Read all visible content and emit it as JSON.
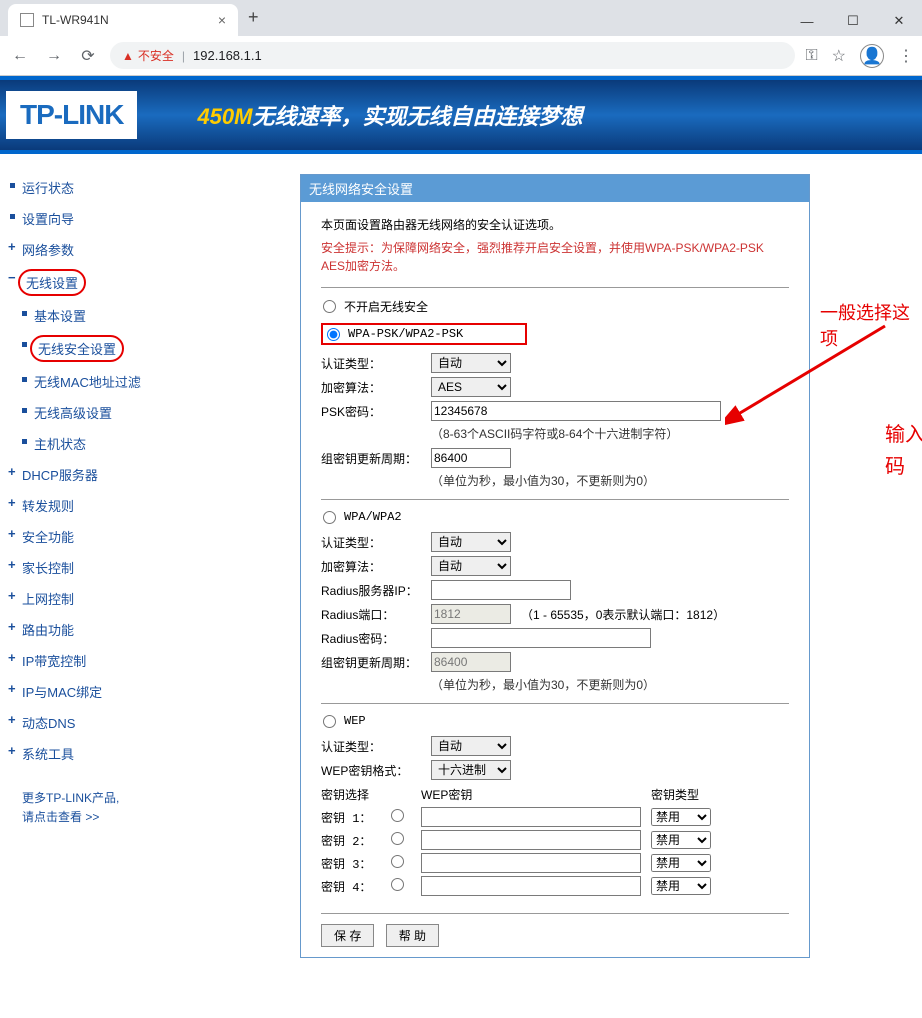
{
  "browser": {
    "tab_title": "TL-WR941N",
    "insecure_label": "不安全",
    "url": "192.168.1.1"
  },
  "banner": {
    "logo": "TP-LINK",
    "slogan_highlight": "450M",
    "slogan_rest": "无线速率，实现无线自由连接梦想"
  },
  "sidebar": {
    "items": [
      "运行状态",
      "设置向导",
      "网络参数",
      "无线设置",
      "基本设置",
      "无线安全设置",
      "无线MAC地址过滤",
      "无线高级设置",
      "主机状态",
      "DHCP服务器",
      "转发规则",
      "安全功能",
      "家长控制",
      "上网控制",
      "路由功能",
      "IP带宽控制",
      "IP与MAC绑定",
      "动态DNS",
      "系统工具"
    ],
    "more1": "更多TP-LINK产品,",
    "more2": "请点击查看 >>"
  },
  "panel": {
    "title": "无线网络安全设置",
    "intro": "本页面设置路由器无线网络的安全认证选项。",
    "warning": "安全提示：为保障网络安全，强烈推荐开启安全设置，并使用WPA-PSK/WPA2-PSK AES加密方法。",
    "opt_disable": "不开启无线安全",
    "opt_wpapsk": "WPA-PSK/WPA2-PSK",
    "auth_type_label": "认证类型：",
    "auth_type_value": "自动",
    "encrypt_label": "加密算法：",
    "encrypt_value_aes": "AES",
    "encrypt_value_auto": "自动",
    "psk_label": "PSK密码：",
    "psk_value": "12345678",
    "psk_hint": "（8-63个ASCII码字符或8-64个十六进制字符）",
    "rekey_label": "组密钥更新周期：",
    "rekey_value": "86400",
    "rekey_hint": "（单位为秒，最小值为30，不更新则为0）",
    "opt_wpa": "WPA/WPA2",
    "radius_ip_label": "Radius服务器IP：",
    "radius_port_label": "Radius端口：",
    "radius_port_value": "1812",
    "radius_port_hint": "（1 - 65535，0表示默认端口：1812）",
    "radius_pw_label": "Radius密码：",
    "rekey2_value": "86400",
    "opt_wep": "WEP",
    "wep_format_label": "WEP密钥格式：",
    "wep_format_value": "十六进制",
    "wep_col_select": "密钥选择",
    "wep_col_key": "WEP密钥",
    "wep_col_type": "密钥类型",
    "wep_keys": [
      "密钥 1：",
      "密钥 2：",
      "密钥 3：",
      "密钥 4："
    ],
    "wep_type_value": "禁用",
    "btn_save": "保 存",
    "btn_help": "帮 助"
  },
  "annotations": {
    "a1": "一般选择这项",
    "a2": "输入你想设置的WiFi密码"
  }
}
